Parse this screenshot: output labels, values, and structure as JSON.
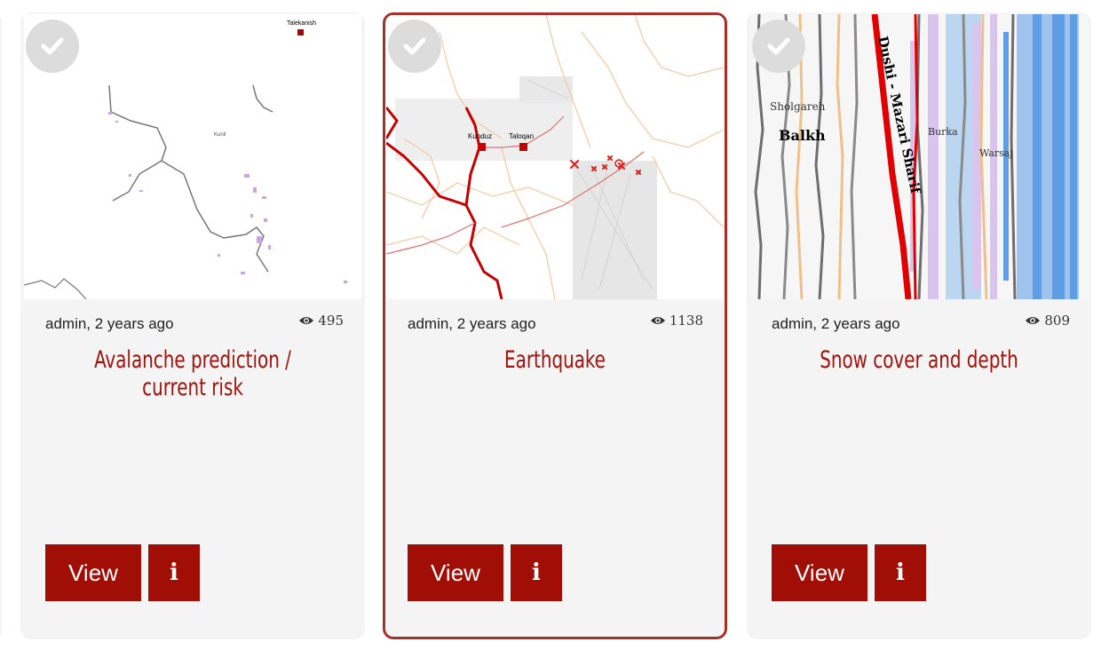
{
  "cards": [
    {
      "author_time": "admin, 2 years ago",
      "views": "495",
      "title_line1": "Avalanche prediction /",
      "title_line2": "current risk",
      "view_label": "View",
      "info_label": "i",
      "map_labels": {
        "city": "Talekanish",
        "region": "Kunil"
      }
    },
    {
      "author_time": "admin, 2 years ago",
      "views": "1138",
      "title_line1": "Earthquake",
      "title_line2": "",
      "view_label": "View",
      "info_label": "i",
      "map_labels": {
        "city1": "Kunduz",
        "city2": "Taloqan"
      }
    },
    {
      "author_time": "admin, 2 years ago",
      "views": "809",
      "title_line1": "Snow cover and depth",
      "title_line2": "",
      "view_label": "View",
      "info_label": "i",
      "map_labels": {
        "l1": "Sholgareh",
        "l2": "Balkh",
        "l3": "Dushi - Mazari Sharif",
        "l4": "Burka",
        "l5": "Warsaj"
      }
    }
  ],
  "colors": {
    "accent": "#a10e05",
    "title": "#a2120c",
    "card_bg": "#f4f4f4",
    "selected_border": "#a6302a"
  },
  "icons": {
    "check": "check-icon",
    "views": "eye-icon"
  }
}
